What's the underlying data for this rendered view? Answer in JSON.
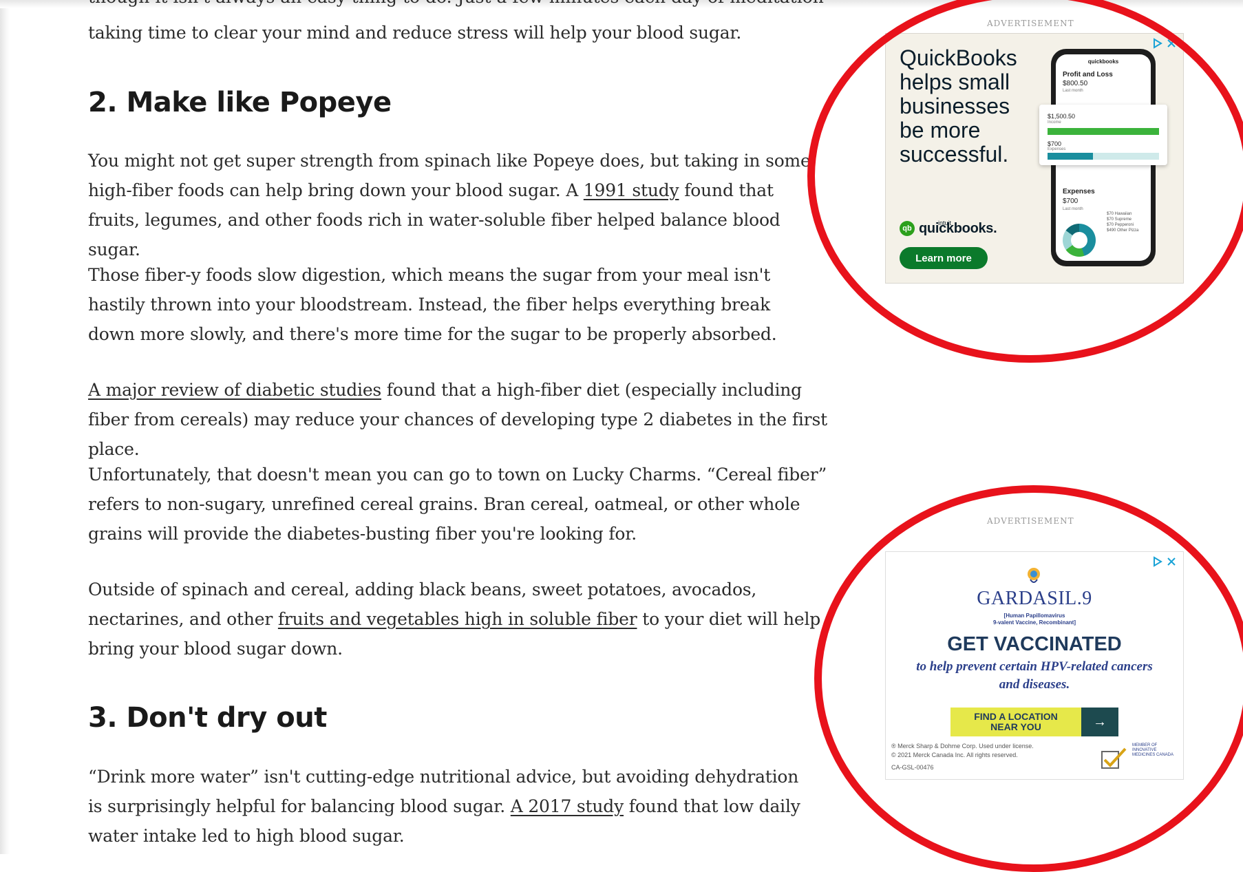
{
  "article": {
    "cut_line_top": "though it isn't always an easy thing to do. Just a few minutes each day of meditation or mindfulness, yoga or walk,",
    "intro_line": "taking time to clear your mind and reduce stress will help your blood sugar.",
    "section2": {
      "heading": "2. Make like Popeye",
      "p1": {
        "before": "You might not get super strength from spinach like Popeye does, but taking in some high-fiber foods can help bring down your blood sugar. A ",
        "link": "1991 study",
        "after": " found that fruits, legumes, and other foods rich in water-soluble fiber helped balance blood sugar."
      },
      "p2": "Those fiber-y foods slow digestion, which means the sugar from your meal isn't hastily thrown into your bloodstream. Instead, the fiber helps everything break down more slowly, and there's more time for the sugar to be properly absorbed.",
      "p3": {
        "link": "A major review of diabetic studies",
        "after": " found that a high-fiber diet (especially including fiber from cereals) may reduce your chances of developing type 2 diabetes in the first place."
      },
      "p4": "Unfortunately, that doesn't mean you can go to town on Lucky Charms. “Cereal fiber” refers to non-sugary, unrefined cereal grains. Bran cereal, oatmeal, or other whole grains will provide the diabetes-busting fiber you're looking for.",
      "p5": {
        "before": "Outside of spinach and cereal, adding black beans, sweet potatoes, avocados, nectarines, and other ",
        "link": "fruits and vegetables high in soluble fiber",
        "after": " to your diet will help bring your blood sugar down."
      }
    },
    "section3": {
      "heading": "3. Don't dry out",
      "p1": {
        "before": "“Drink more water” isn't cutting-edge nutritional advice, but avoiding dehydration is surprisingly helpful for balancing blood sugar. ",
        "link": "A 2017 study",
        "after": " found that low daily water intake led to high blood sugar."
      }
    }
  },
  "ad1": {
    "label": "ADVERTISEMENT",
    "headline": "QuickBooks helps small businesses be more successful.",
    "brand_intuit": "intuit",
    "brand": "quickbooks.",
    "cta": "Learn more",
    "phone_brand": "quickbooks",
    "pl_title": "Profit and Loss",
    "pl_amount": "$800.50",
    "pl_sub": "Last month",
    "income_amount": "$1,500.50",
    "income_label": "Income",
    "expenses_small": "$700",
    "expenses_label": "Expenses",
    "exp_title": "Expenses",
    "exp_amount": "$700",
    "exp_sub": "Last month",
    "legend": [
      "$70 Hawaiian",
      "$70 Supreme",
      "$70 Pepperoni",
      "$490 Other Pizza"
    ]
  },
  "ad2": {
    "label": "ADVERTISEMENT",
    "brand": "GARDASIL.9",
    "sub1": "[Human Papillomavirus",
    "sub2": "9-valent Vaccine, Recombinant]",
    "cta": "GET VACCINATED",
    "tagline": "to help prevent certain HPV-related cancers and diseases.",
    "button_line1": "FIND A LOCATION",
    "button_line2": "NEAR YOU",
    "legal1": "® Merck Sharp & Dohme Corp. Used under license.",
    "legal2": "© 2021 Merck Canada Inc. All rights reserved.",
    "code": "CA-GSL-00476",
    "imc": "MEMBER OF INNOVATIVE MEDICINES CANADA"
  },
  "colors": {
    "annotation_red": "#e8121b",
    "quickbooks_green": "#2ca01c",
    "gardasil_blue": "#2b3f8a",
    "button_yellow": "#e6e84a"
  },
  "icons": {
    "adchoices": "adchoices-icon",
    "close": "close-icon",
    "arrow": "arrow-right-icon"
  }
}
